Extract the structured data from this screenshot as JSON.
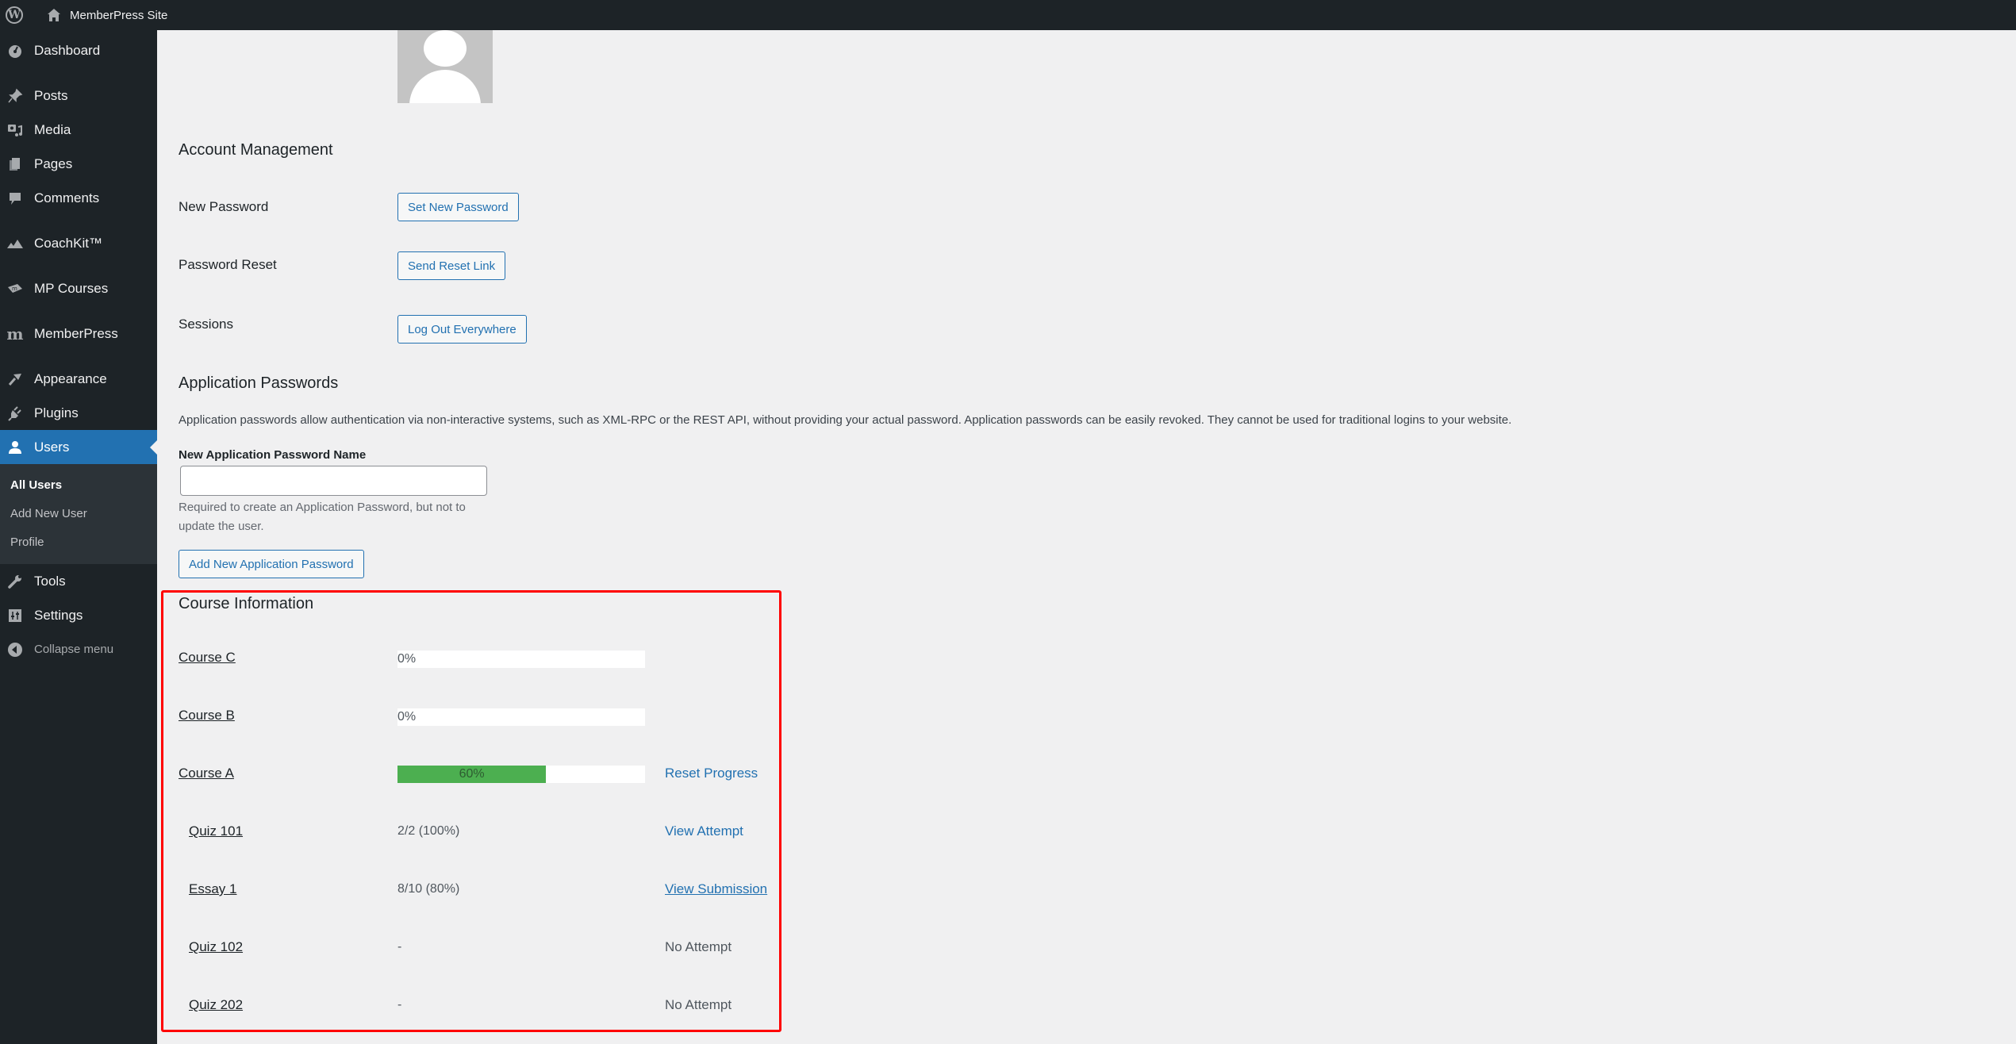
{
  "adminbar": {
    "site_name": "MemberPress Site"
  },
  "sidebar": {
    "items": [
      {
        "label": "Dashboard",
        "icon": "dashboard-icon"
      },
      {
        "label": "Posts",
        "icon": "pin-icon"
      },
      {
        "label": "Media",
        "icon": "media-icon"
      },
      {
        "label": "Pages",
        "icon": "pages-icon"
      },
      {
        "label": "Comments",
        "icon": "comment-icon"
      },
      {
        "label": "CoachKit™",
        "icon": "mountains-icon"
      },
      {
        "label": "MP Courses",
        "icon": "courses-icon"
      },
      {
        "label": "MemberPress",
        "icon": "memberpress-icon"
      },
      {
        "label": "Appearance",
        "icon": "brush-icon"
      },
      {
        "label": "Plugins",
        "icon": "plug-icon"
      },
      {
        "label": "Users",
        "icon": "user-icon",
        "active": true
      },
      {
        "label": "Tools",
        "icon": "wrench-icon"
      },
      {
        "label": "Settings",
        "icon": "settings-icon"
      }
    ],
    "users_submenu": [
      {
        "label": "All Users",
        "current": true
      },
      {
        "label": "Add New User"
      },
      {
        "label": "Profile"
      }
    ],
    "collapse_label": "Collapse menu"
  },
  "account_management": {
    "title": "Account Management",
    "rows": [
      {
        "label": "New Password",
        "button": "Set New Password"
      },
      {
        "label": "Password Reset",
        "button": "Send Reset Link"
      },
      {
        "label": "Sessions",
        "button": "Log Out Everywhere"
      }
    ]
  },
  "app_passwords": {
    "title": "Application Passwords",
    "description": "Application passwords allow authentication via non-interactive systems, such as XML-RPC or the REST API, without providing your actual password. Application passwords can be easily revoked. They cannot be used for traditional logins to your website.",
    "field_label": "New Application Password Name",
    "field_value": "",
    "help": "Required to create an Application Password, but not to update the user.",
    "button": "Add New Application Password"
  },
  "course_info": {
    "title": "Course Information",
    "highlight_color": "#ff0000",
    "progress_color": "#4caf50",
    "courses": [
      {
        "name": "Course C",
        "progress": 0,
        "progress_label": "0%"
      },
      {
        "name": "Course B",
        "progress": 0,
        "progress_label": "0%"
      },
      {
        "name": "Course A",
        "progress": 60,
        "progress_label": "60%",
        "action": "Reset Progress"
      }
    ],
    "assessments": [
      {
        "name": "Quiz 101",
        "score": "2/2 (100%)",
        "action": "View Attempt",
        "action_type": "link"
      },
      {
        "name": "Essay 1",
        "score": "8/10 (80%)",
        "action": "View Submission",
        "action_type": "link-underlined"
      },
      {
        "name": "Quiz 102",
        "score": "-",
        "action": "No Attempt",
        "action_type": "text"
      },
      {
        "name": "Quiz 202",
        "score": "-",
        "action": "No Attempt",
        "action_type": "text"
      }
    ]
  }
}
